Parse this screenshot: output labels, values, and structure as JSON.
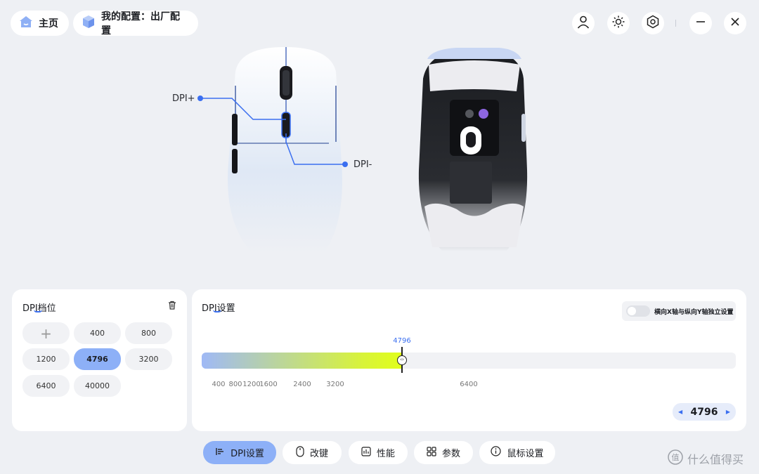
{
  "topbar": {
    "home_label": "主页",
    "config_label": "我的配置：出厂配置"
  },
  "mouse": {
    "dpi_plus_label": "DPI+",
    "dpi_minus_label": "DPI-"
  },
  "dpi_levels_panel": {
    "title": "DPI档位",
    "levels": [
      "400",
      "800",
      "1200",
      "4796",
      "3200",
      "6400",
      "40000"
    ],
    "selected": "4796"
  },
  "dpi_settings_panel": {
    "title": "DPI设置",
    "independent_xy_label": "横向X轴与纵向Y轴独立设置",
    "independent_xy_on": false,
    "slider_value": "4796",
    "slider_fraction": 0.375,
    "ticks": [
      "400",
      "800",
      "1200",
      "1600",
      "2400",
      "3200",
      "6400"
    ],
    "stepper_value": "4796"
  },
  "bottom_tabs": [
    {
      "label": "DPI设置",
      "icon": "dpi-settings-icon",
      "active": true
    },
    {
      "label": "改键",
      "icon": "mouse-key-icon",
      "active": false
    },
    {
      "label": "性能",
      "icon": "performance-icon",
      "active": false
    },
    {
      "label": "参数",
      "icon": "parameters-icon",
      "active": false
    },
    {
      "label": "鼠标设置",
      "icon": "info-icon",
      "active": false
    }
  ],
  "watermark": "什么值得买",
  "colors": {
    "accent": "#3b6ff0",
    "active_chip": "#8db0f7",
    "slider_start": "#9fb9f6",
    "slider_end": "#e1ff1a"
  }
}
